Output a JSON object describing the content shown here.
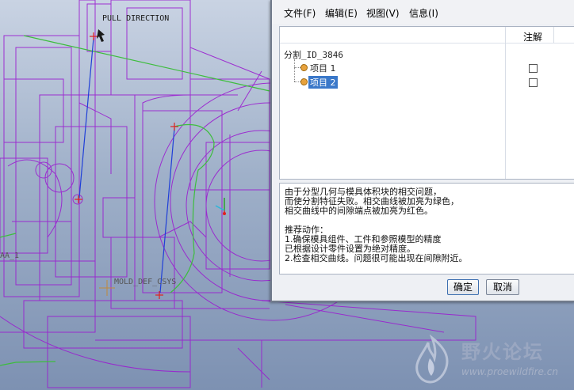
{
  "viewport": {
    "labels": {
      "pull_direction": "PULL DIRECTION",
      "mold_csys": "MOLD_DEF_CSYS",
      "axis_fragment": "AA_1"
    },
    "colors": {
      "wireframe": "#9a1fd0",
      "green_edge": "#3dbd3d",
      "blue_line": "#1f3fd8",
      "red_point": "#e02020",
      "background": "#9fb0c9"
    }
  },
  "dialog": {
    "menu": [
      "文件(F)",
      "编辑(E)",
      "视图(V)",
      "信息(I)"
    ],
    "columns": {
      "notes": "注解"
    },
    "tree": {
      "root": "分割_ID_3846",
      "items": [
        {
          "label": "项目 1",
          "selected": false,
          "checked": false
        },
        {
          "label": "项目 2",
          "selected": true,
          "checked": false
        }
      ]
    },
    "message": [
      "由于分型几何与模具体积块的相交问题，",
      "而使分割特征失败。相交曲线被加亮为绿色，",
      "相交曲线中的间隙端点被加亮为红色。",
      "",
      "推荐动作：",
      "1.确保模具组件、工件和参照模型的精度",
      "   已根据设计零件设置为绝对精度。",
      "2.检查相交曲线。问题很可能出现在间隙附近。"
    ],
    "buttons": {
      "ok": "确定",
      "cancel": "取消"
    }
  },
  "watermark": {
    "title": "野火论坛",
    "url": "www.proewildfire.cn"
  }
}
